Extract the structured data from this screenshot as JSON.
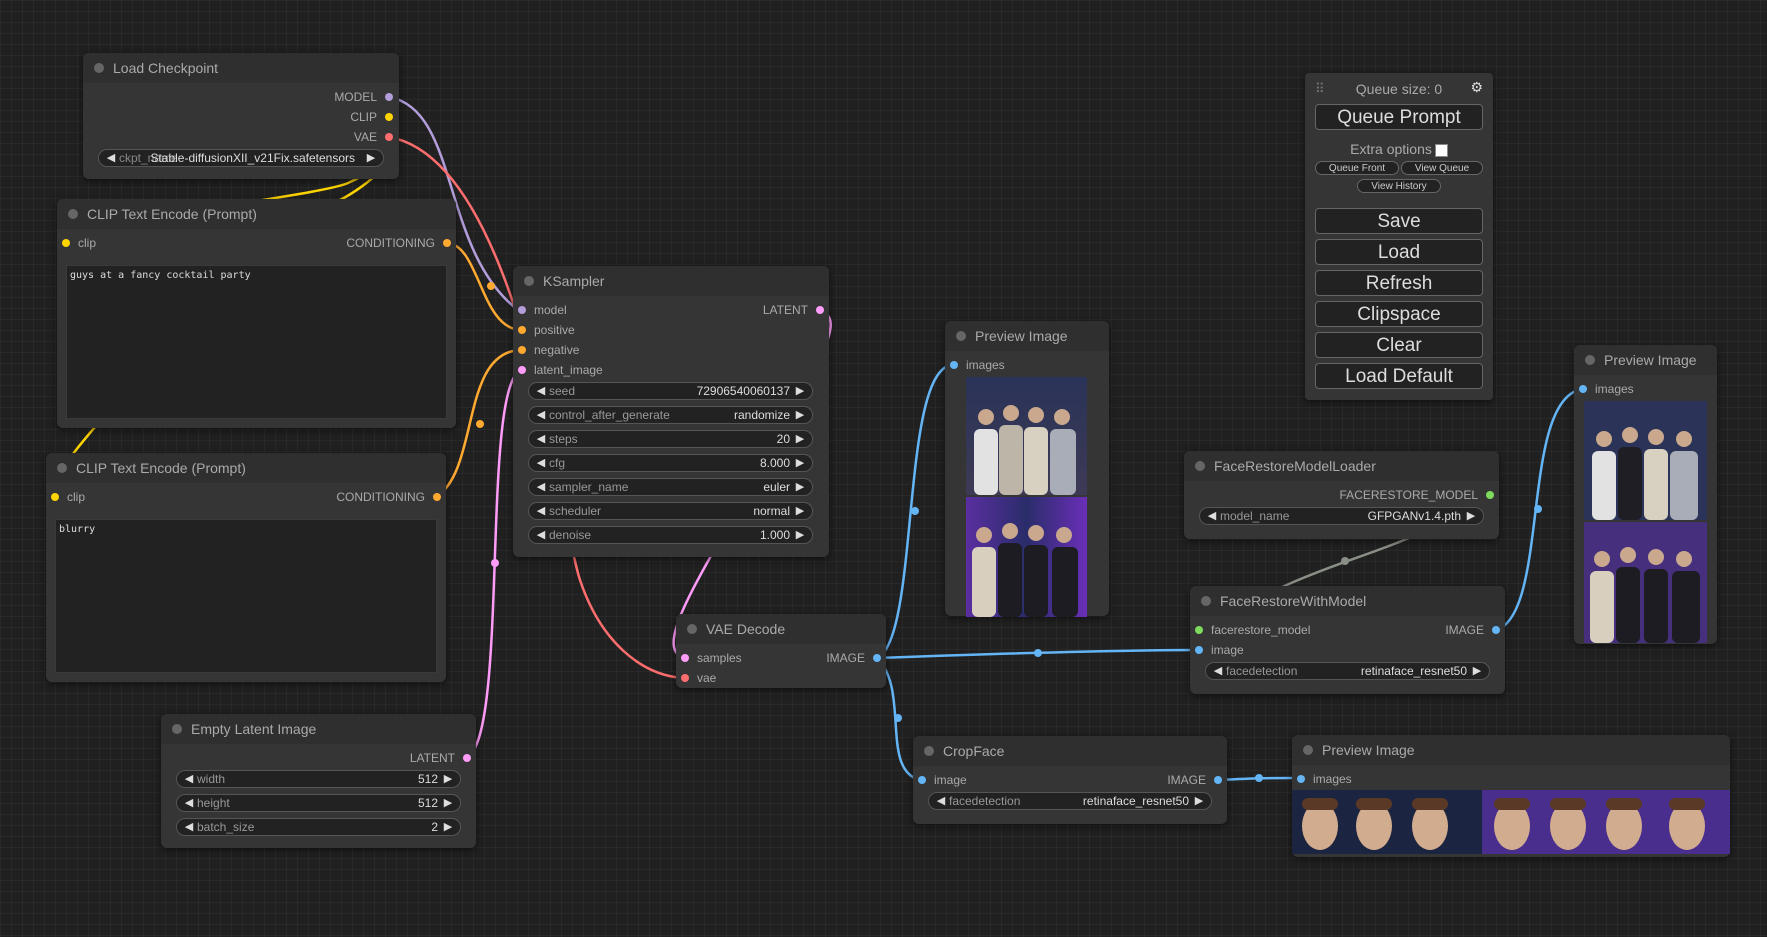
{
  "colors": {
    "model": "#b39ddb",
    "clip": "#ffd500",
    "vae": "#ff6e6e",
    "conditioning": "#ffa931",
    "latent": "#ff9cf9",
    "image": "#64b5f6",
    "facerestore_model": "#7ddc5b"
  },
  "nodes": {
    "load_checkpoint": {
      "title": "Load Checkpoint",
      "outputs": [
        "MODEL",
        "CLIP",
        "VAE"
      ],
      "ckpt_label": "ckpt_name",
      "ckpt_value": "Stable-diffusionXII_v21Fix.safetensors"
    },
    "clip_pos": {
      "title": "CLIP Text Encode (Prompt)",
      "input": "clip",
      "output": "CONDITIONING",
      "text": "guys at a fancy cocktail party"
    },
    "clip_neg": {
      "title": "CLIP Text Encode (Prompt)",
      "input": "clip",
      "output": "CONDITIONING",
      "text": "blurry"
    },
    "empty_latent": {
      "title": "Empty Latent Image",
      "output": "LATENT",
      "widgets": [
        {
          "label": "width",
          "value": "512"
        },
        {
          "label": "height",
          "value": "512"
        },
        {
          "label": "batch_size",
          "value": "2"
        }
      ]
    },
    "ksampler": {
      "title": "KSampler",
      "inputs": [
        "model",
        "positive",
        "negative",
        "latent_image"
      ],
      "output": "LATENT",
      "widgets": [
        {
          "label": "seed",
          "value": "72906540060137"
        },
        {
          "label": "control_after_generate",
          "value": "randomize"
        },
        {
          "label": "steps",
          "value": "20"
        },
        {
          "label": "cfg",
          "value": "8.000"
        },
        {
          "label": "sampler_name",
          "value": "euler"
        },
        {
          "label": "scheduler",
          "value": "normal"
        },
        {
          "label": "denoise",
          "value": "1.000"
        }
      ]
    },
    "vae_decode": {
      "title": "VAE Decode",
      "inputs": [
        "samples",
        "vae"
      ],
      "output": "IMAGE"
    },
    "preview1": {
      "title": "Preview Image",
      "input": "images"
    },
    "preview2": {
      "title": "Preview Image",
      "input": "images"
    },
    "preview3": {
      "title": "Preview Image",
      "input": "images"
    },
    "fr_loader": {
      "title": "FaceRestoreModelLoader",
      "output": "FACERESTORE_MODEL",
      "widget": {
        "label": "model_name",
        "value": "GFPGANv1.4.pth"
      }
    },
    "fr_with_model": {
      "title": "FaceRestoreWithModel",
      "inputs": [
        "facerestore_model",
        "image"
      ],
      "output": "IMAGE",
      "widget": {
        "label": "facedetection",
        "value": "retinaface_resnet50"
      }
    },
    "crop_face": {
      "title": "CropFace",
      "input": "image",
      "output": "IMAGE",
      "widget": {
        "label": "facedetection",
        "value": "retinaface_resnet50"
      }
    }
  },
  "menu": {
    "queue_size": "Queue size: 0",
    "queue_prompt": "Queue Prompt",
    "extra_options": "Extra options",
    "queue_front": "Queue Front",
    "view_queue": "View Queue",
    "view_history": "View History",
    "save": "Save",
    "load": "Load",
    "refresh": "Refresh",
    "clipspace": "Clipspace",
    "clear": "Clear",
    "load_default": "Load Default"
  }
}
